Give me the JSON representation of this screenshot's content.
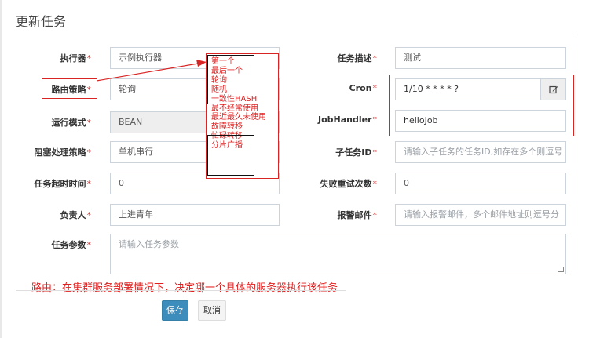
{
  "page": {
    "title": "更新任务"
  },
  "form": {
    "executor": {
      "label": "执行器",
      "required": "*",
      "value": "示例执行器"
    },
    "route": {
      "label": "路由策略",
      "required": "*",
      "value": "轮询"
    },
    "run_mode": {
      "label": "运行模式",
      "required": "*",
      "value": "BEAN"
    },
    "block": {
      "label": "阻塞处理策略",
      "required": "*",
      "value": "单机串行"
    },
    "timeout": {
      "label": "任务超时时间",
      "required": "*",
      "value": "0"
    },
    "owner": {
      "label": "负责人",
      "required": "*",
      "value": "上进青年"
    },
    "desc": {
      "label": "任务描述",
      "required": "*",
      "value": "测试"
    },
    "cron": {
      "label": "Cron",
      "required": "*",
      "value": "1/10 * * * * ?"
    },
    "handler": {
      "label": "JobHandler",
      "required": "*",
      "value": "helloJob"
    },
    "child": {
      "label": "子任务ID",
      "required": "*",
      "placeholder": "请输入子任务的任务ID,如存在多个则逗号"
    },
    "retry": {
      "label": "失败重试次数",
      "required": "*",
      "value": "0"
    },
    "email": {
      "label": "报警邮件",
      "required": "*",
      "placeholder": "请输入报警邮件，多个邮件地址则逗号分"
    },
    "params": {
      "label": "任务参数",
      "required": "*",
      "placeholder": "请输入任务参数"
    }
  },
  "route_options": [
    "第一个",
    "最后一个",
    "轮询",
    "随机",
    "一致性HASH",
    "最不经常使用",
    "最近最久未使用",
    "故障转移",
    "忙碌转移",
    "分片广播"
  ],
  "annotation": {
    "text": "路由：在集群服务部署情况下，决定哪一个具体的服务器执行该任务"
  },
  "buttons": {
    "save": "保存",
    "cancel": "取消"
  },
  "icons": {
    "cron_edit": "edit-icon"
  },
  "colors": {
    "primary": "#3c8dbc",
    "annotation": "#e02020"
  }
}
